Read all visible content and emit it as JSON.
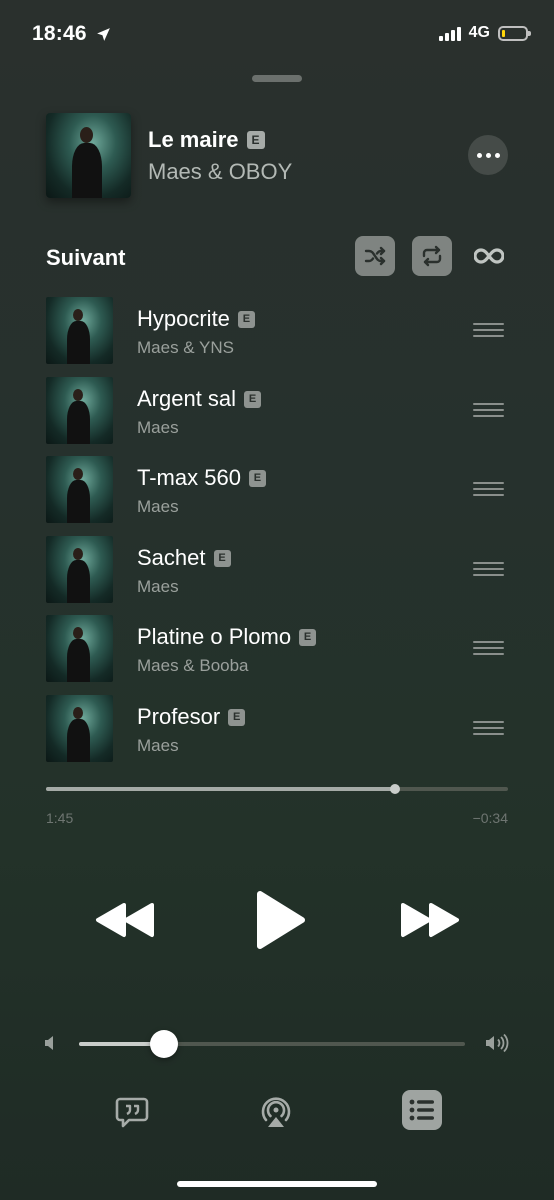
{
  "status_bar": {
    "time": "18:46",
    "network": "4G",
    "battery_level": 0.15
  },
  "now_playing": {
    "title": "Le maire",
    "explicit": "E",
    "artist": "Maes & OBOY"
  },
  "up_next": {
    "label": "Suivant",
    "items": [
      {
        "title": "Hypocrite",
        "artist": "Maes & YNS",
        "explicit": "E"
      },
      {
        "title": "Argent sal",
        "artist": "Maes",
        "explicit": "E"
      },
      {
        "title": "T-max 560",
        "artist": "Maes",
        "explicit": "E"
      },
      {
        "title": "Sachet",
        "artist": "Maes",
        "explicit": "E"
      },
      {
        "title": "Platine o Plomo",
        "artist": "Maes & Booba",
        "explicit": "E"
      },
      {
        "title": "Profesor",
        "artist": "Maes",
        "explicit": "E"
      }
    ]
  },
  "playback": {
    "elapsed": "1:45",
    "remaining": "−0:34",
    "progress": 0.755
  },
  "volume": {
    "level": 0.22
  },
  "colors": {
    "background": "#26312d",
    "explicit_badge": "#a6aba8",
    "active_button": "#7f8481"
  },
  "icons": [
    "location-arrow-icon",
    "signal-icon",
    "battery-icon",
    "more-icon",
    "shuffle-icon",
    "repeat-icon",
    "infinity-icon",
    "drag-handle-icon",
    "rewind-icon",
    "play-icon",
    "fast-forward-icon",
    "volume-low-icon",
    "volume-high-icon",
    "lyrics-icon",
    "airplay-icon",
    "queue-list-icon"
  ]
}
